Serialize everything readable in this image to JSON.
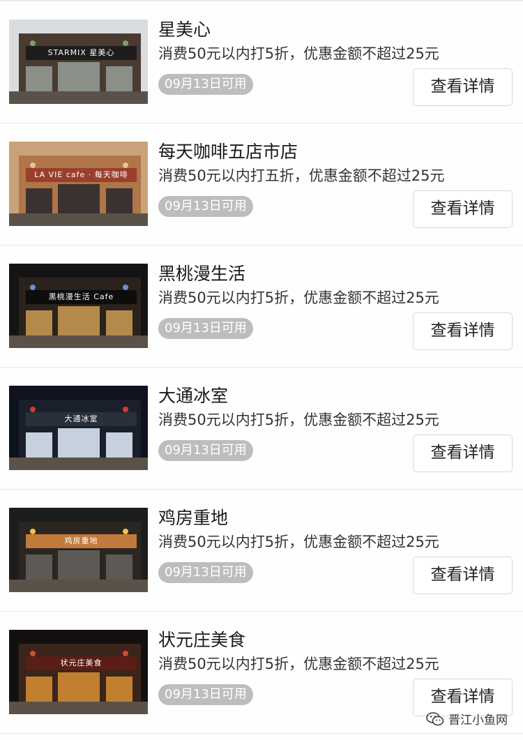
{
  "stores": [
    {
      "name": "星美心",
      "offer": "消费50元以内打5折，优惠金额不超过25元",
      "available": "09月13日可用",
      "button": "查看详情",
      "thumb": {
        "sign": "STARMIX 星美心",
        "sky": "#d9dde0",
        "facade": "#4a3a30",
        "sign_bg": "#1c1c1c",
        "glass": "#8a8f88",
        "accent": "#7f9f6a"
      }
    },
    {
      "name": "每天咖啡五店市店",
      "offer": "消费50元以内打五折，优惠金额不超过25元",
      "available": "09月13日可用",
      "button": "查看详情",
      "thumb": {
        "sign": "LA VIE cafe · 每天咖啡",
        "sky": "#c9a27a",
        "facade": "#b07548",
        "sign_bg": "#9a3f2c",
        "glass": "#3a3230",
        "accent": "#e0c3a0"
      }
    },
    {
      "name": "黑桃漫生活",
      "offer": "消费50元以内打5折，优惠金额不超过25元",
      "available": "09月13日可用",
      "button": "查看详情",
      "thumb": {
        "sign": "黑桃漫生活 Cafe",
        "sky": "#141414",
        "facade": "#2a221c",
        "sign_bg": "#0d0d0d",
        "glass": "#b38a4a",
        "accent": "#6d8fd6"
      }
    },
    {
      "name": "大通冰室",
      "offer": "消费50元以内打5折，优惠金额不超过25元",
      "available": "09月13日可用",
      "button": "查看详情",
      "thumb": {
        "sign": "大通冰室",
        "sky": "#0f1320",
        "facade": "#1b1f2c",
        "sign_bg": "#2a2f3c",
        "glass": "#c7d1de",
        "accent": "#d23a2a"
      }
    },
    {
      "name": "鸡房重地",
      "offer": "消费50元以内打5折，优惠金额不超过25元",
      "available": "09月13日可用",
      "button": "查看详情",
      "thumb": {
        "sign": "鸡房重地",
        "sky": "#1d1d1d",
        "facade": "#2b2622",
        "sign_bg": "#c27a3c",
        "glass": "#5d5a55",
        "accent": "#f1c24a"
      }
    },
    {
      "name": "状元庄美食",
      "offer": "消费50元以内打5折，优惠金额不超过25元",
      "available": "09月13日可用",
      "button": "查看详情",
      "thumb": {
        "sign": "状元庄美食",
        "sky": "#141010",
        "facade": "#3a241c",
        "sign_bg": "#5a1e16",
        "glass": "#c0802f",
        "accent": "#d84a32"
      }
    }
  ],
  "watermark": {
    "text": "晋江小鱼网",
    "icon": "wechat-icon"
  }
}
